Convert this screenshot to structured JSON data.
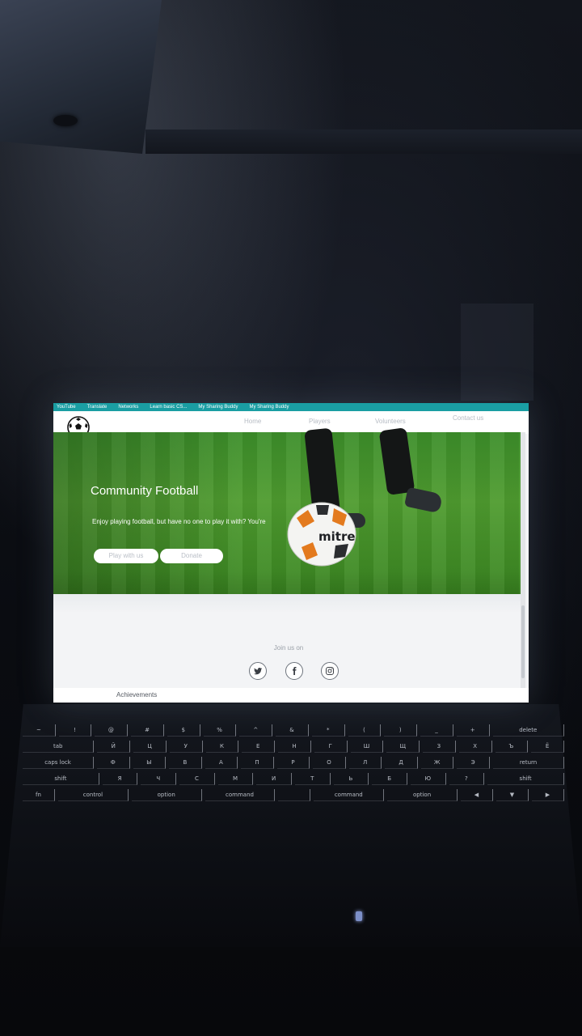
{
  "bookmarks": [
    "YouTube",
    "Translate",
    "Networks",
    "Learn basic CS...",
    "My Sharing Buddy",
    "My Sharing Buddy"
  ],
  "nav": {
    "home": "Home",
    "players": "Players",
    "volunteers": "Volunteers",
    "contact": "Contact us"
  },
  "hero": {
    "title": "Community Football",
    "text": "Enjoy playing football, but have no one to play it with? You're",
    "play_button": "Play with us",
    "donate_button": "Donate",
    "ball_brand": "mitre"
  },
  "footer": {
    "join_label": "Join us on",
    "social_icons": [
      "twitter-icon",
      "facebook-icon",
      "instagram-icon"
    ]
  },
  "partial_section": "Achievements",
  "keyboard": {
    "row1": [
      "~",
      "!",
      "@",
      "#",
      "$",
      "%",
      "^",
      "&",
      "*",
      "(",
      ")",
      "_",
      "+",
      "delete"
    ],
    "row2": [
      "tab",
      "Й",
      "Ц",
      "У",
      "К",
      "Е",
      "Н",
      "Г",
      "Ш",
      "Щ",
      "З",
      "Х",
      "Ъ",
      "Ё"
    ],
    "row3": [
      "caps lock",
      "Ф",
      "Ы",
      "В",
      "А",
      "П",
      "Р",
      "О",
      "Л",
      "Д",
      "Ж",
      "Э",
      "return"
    ],
    "row4": [
      "shift",
      "Я",
      "Ч",
      "С",
      "М",
      "И",
      "Т",
      "Ь",
      "Б",
      "Ю",
      "?",
      "shift"
    ],
    "row5": [
      "fn",
      "control",
      "option",
      "command",
      "",
      "command",
      "option",
      "◀",
      "▼",
      "▶"
    ]
  },
  "colors": {
    "bookmark_bar": "#1a9ea3",
    "grass": "#4f9c2f",
    "page_bg": "#f3f4f6"
  }
}
